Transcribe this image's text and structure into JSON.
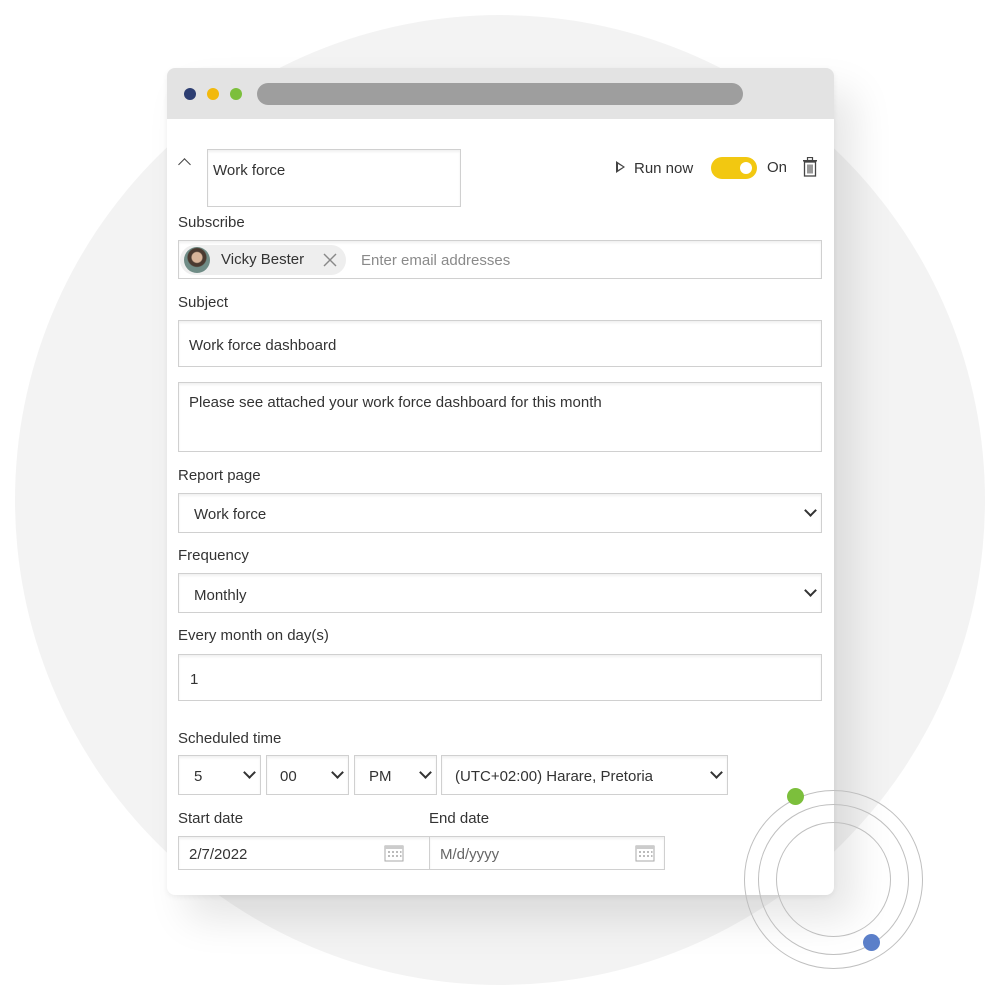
{
  "window": {
    "traffic_lights": [
      "#2d3e72",
      "#f2b90d",
      "#7cbf3c"
    ]
  },
  "header": {
    "name_value": "Work force",
    "run_now_label": "Run now",
    "toggle_label": "On",
    "toggle_color": "#f2c811",
    "toggle_on": true
  },
  "subscribe": {
    "label": "Subscribe",
    "recipient": "Vicky Bester",
    "placeholder": "Enter email addresses"
  },
  "subject": {
    "label": "Subject",
    "value": "Work force dashboard"
  },
  "message": {
    "value": "Please see attached your work force dashboard for this month"
  },
  "report_page": {
    "label": "Report page",
    "selected": "Work force"
  },
  "frequency": {
    "label": "Frequency",
    "selected": "Monthly"
  },
  "day": {
    "label": "Every month on day(s)",
    "value": "1"
  },
  "scheduled_time": {
    "label": "Scheduled time",
    "hour": "5",
    "minute": "00",
    "ampm": "PM",
    "timezone": "(UTC+02:00) Harare, Pretoria"
  },
  "start_date": {
    "label": "Start date",
    "value": "2/7/2022"
  },
  "end_date": {
    "label": "End date",
    "placeholder": "M/d/yyyy"
  },
  "decoration": {
    "green_dot_color": "#7cbf3c",
    "blue_dot_color": "#5b7fc9"
  }
}
